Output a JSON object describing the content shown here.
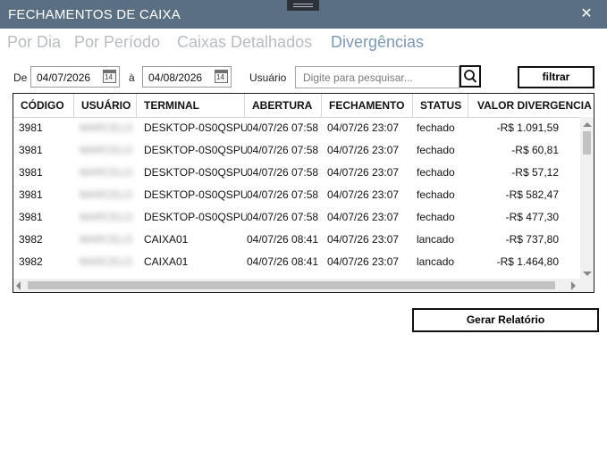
{
  "window": {
    "title": "FECHAMENTOS DE CAIXA",
    "close_glyph": "✕"
  },
  "tabs": [
    {
      "label": "Por Dia",
      "active": false
    },
    {
      "label": "Por Período",
      "active": false
    },
    {
      "label": "Caixas Detalhados",
      "active": false
    },
    {
      "label": "Divergências",
      "active": true
    }
  ],
  "filters": {
    "from_label": "De",
    "from_date": "04/07/2026",
    "between_label": "à",
    "to_date": "04/08/2026",
    "calendar_icon_text": "14",
    "user_label": "Usuário",
    "search_value": "",
    "search_placeholder": "Digite para pesquisar...",
    "filter_button": "filtrar"
  },
  "table": {
    "columns": [
      "CÓDIGO",
      "USUÁRIO",
      "TERMINAL",
      "ABERTURA",
      "FECHAMENTO",
      "STATUS",
      "VALOR DIVERGENCIA"
    ],
    "rows": [
      {
        "codigo": "3981",
        "usuario": "MARCELO",
        "terminal": "DESKTOP-0S0QSPU",
        "abertura": "04/07/26 07:58",
        "fechamento": "04/07/26 23:07",
        "status": "fechado",
        "valor": "-R$ 1.091,59"
      },
      {
        "codigo": "3981",
        "usuario": "MARCELO",
        "terminal": "DESKTOP-0S0QSPU",
        "abertura": "04/07/26 07:58",
        "fechamento": "04/07/26 23:07",
        "status": "fechado",
        "valor": "-R$ 60,81"
      },
      {
        "codigo": "3981",
        "usuario": "MARCELO",
        "terminal": "DESKTOP-0S0QSPU",
        "abertura": "04/07/26 07:58",
        "fechamento": "04/07/26 23:07",
        "status": "fechado",
        "valor": "-R$ 57,12"
      },
      {
        "codigo": "3981",
        "usuario": "MARCELO",
        "terminal": "DESKTOP-0S0QSPU",
        "abertura": "04/07/26 07:58",
        "fechamento": "04/07/26 23:07",
        "status": "fechado",
        "valor": "-R$ 582,47"
      },
      {
        "codigo": "3981",
        "usuario": "MARCELO",
        "terminal": "DESKTOP-0S0QSPU",
        "abertura": "04/07/26 07:58",
        "fechamento": "04/07/26 23:07",
        "status": "fechado",
        "valor": "-R$ 477,30"
      },
      {
        "codigo": "3982",
        "usuario": "MARCELO",
        "terminal": "CAIXA01",
        "abertura": "04/07/26 08:41",
        "fechamento": "04/07/26 23:07",
        "status": "lancado",
        "valor": "-R$ 737,80"
      },
      {
        "codigo": "3982",
        "usuario": "MARCELO",
        "terminal": "CAIXA01",
        "abertura": "04/07/26 08:41",
        "fechamento": "04/07/26 23:07",
        "status": "lancado",
        "valor": "-R$ 1.464,80"
      }
    ]
  },
  "footer": {
    "report_button": "Gerar Relatório"
  }
}
